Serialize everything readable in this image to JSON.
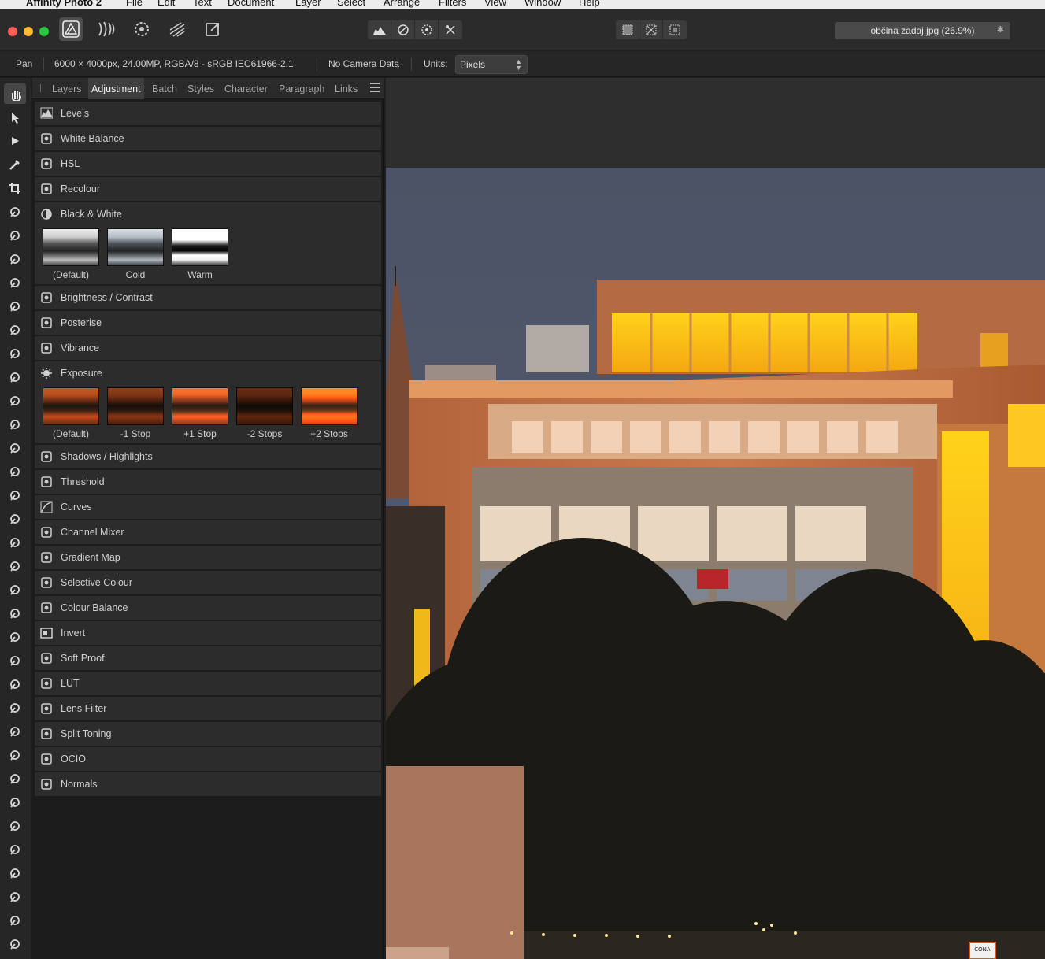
{
  "menubar": {
    "app_name": "Affinity Photo 2",
    "items": [
      "File",
      "Edit",
      "Text",
      "Document",
      "Layer",
      "Select",
      "Arrange",
      "Filters",
      "View",
      "Window",
      "Help"
    ]
  },
  "toolbar": {
    "document_tab": "občina zadaj.jpg (26.9%)",
    "document_tab_star": "✱",
    "personas": [
      "photo-persona-icon",
      "liquify-persona-icon",
      "develop-persona-icon",
      "tone-mapping-persona-icon",
      "export-persona-icon"
    ],
    "colors": {
      "close": "#ff5f57",
      "minimize": "#febc2e",
      "zoom": "#28c840"
    }
  },
  "context_bar": {
    "tool_name": "Pan",
    "document_info": "6000 × 4000px, 24.00MP, RGBA/8 - sRGB IEC61966-2.1",
    "camera_data": "No Camera Data",
    "units_label": "Units:",
    "units_value": "Pixels"
  },
  "panel": {
    "tabs": [
      "Layers",
      "Adjustment",
      "Batch",
      "Styles",
      "Character",
      "Paragraph",
      "Links"
    ],
    "active_tab": "Adjustment",
    "adjustments": [
      {
        "label": "Levels",
        "icon": "levels-icon"
      },
      {
        "label": "White Balance",
        "icon": "white-balance-icon"
      },
      {
        "label": "HSL",
        "icon": "hsl-icon"
      },
      {
        "label": "Recolour",
        "icon": "recolour-icon"
      },
      {
        "label": "Black & White",
        "icon": "black-white-icon",
        "presets": [
          "(Default)",
          "Cold",
          "Warm"
        ]
      },
      {
        "label": "Brightness / Contrast",
        "icon": "brightness-contrast-icon"
      },
      {
        "label": "Posterise",
        "icon": "posterise-icon"
      },
      {
        "label": "Vibrance",
        "icon": "vibrance-icon"
      },
      {
        "label": "Exposure",
        "icon": "exposure-icon",
        "presets": [
          "(Default)",
          "-1 Stop",
          "+1 Stop",
          "-2 Stops",
          "+2 Stops"
        ]
      },
      {
        "label": "Shadows / Highlights",
        "icon": "shadows-highlights-icon"
      },
      {
        "label": "Threshold",
        "icon": "threshold-icon"
      },
      {
        "label": "Curves",
        "icon": "curves-icon"
      },
      {
        "label": "Channel Mixer",
        "icon": "channel-mixer-icon"
      },
      {
        "label": "Gradient Map",
        "icon": "gradient-map-icon"
      },
      {
        "label": "Selective Colour",
        "icon": "selective-colour-icon"
      },
      {
        "label": "Colour Balance",
        "icon": "colour-balance-icon"
      },
      {
        "label": "Invert",
        "icon": "invert-icon"
      },
      {
        "label": "Soft Proof",
        "icon": "soft-proof-icon"
      },
      {
        "label": "LUT",
        "icon": "lut-icon"
      },
      {
        "label": "Lens Filter",
        "icon": "lens-filter-icon"
      },
      {
        "label": "Split Toning",
        "icon": "split-toning-icon"
      },
      {
        "label": "OCIO",
        "icon": "ocio-icon"
      },
      {
        "label": "Normals",
        "icon": "normals-icon"
      }
    ]
  },
  "tools": [
    "view-tool-icon",
    "move-tool-icon",
    "node-tool-icon",
    "color-picker-icon",
    "crop-tool-icon",
    "selection-brush-icon",
    "flood-select-icon",
    "pen-tool-icon",
    "clone-brush-icon",
    "healing-brush-icon",
    "marquee-tool-icon",
    "perspective-tool-icon",
    "mesh-warp-icon",
    "smudge-tool-icon",
    "dodge-tool-icon",
    "paint-brush-icon",
    "mixer-brush-icon",
    "blemish-remover-icon",
    "erase-brush-icon",
    "inpainting-brush-icon",
    "red-eye-icon",
    "patch-tool-icon",
    "zoom-tool-icon",
    "fill-tool-icon",
    "ellipse-tool-icon",
    "artistic-text-icon",
    "sharpen-tool-icon",
    "frame-text-icon",
    "vector-crop-icon",
    "table-tool-icon",
    "sum-tool-icon",
    "burn-tool-icon",
    "spiral-tool-icon",
    "blur-tool-icon",
    "add-fill-icon",
    "flash-tool-icon",
    "gradient-tool-icon"
  ],
  "canvas": {
    "background": "#2e2e2e",
    "sign_text": "CONA"
  }
}
